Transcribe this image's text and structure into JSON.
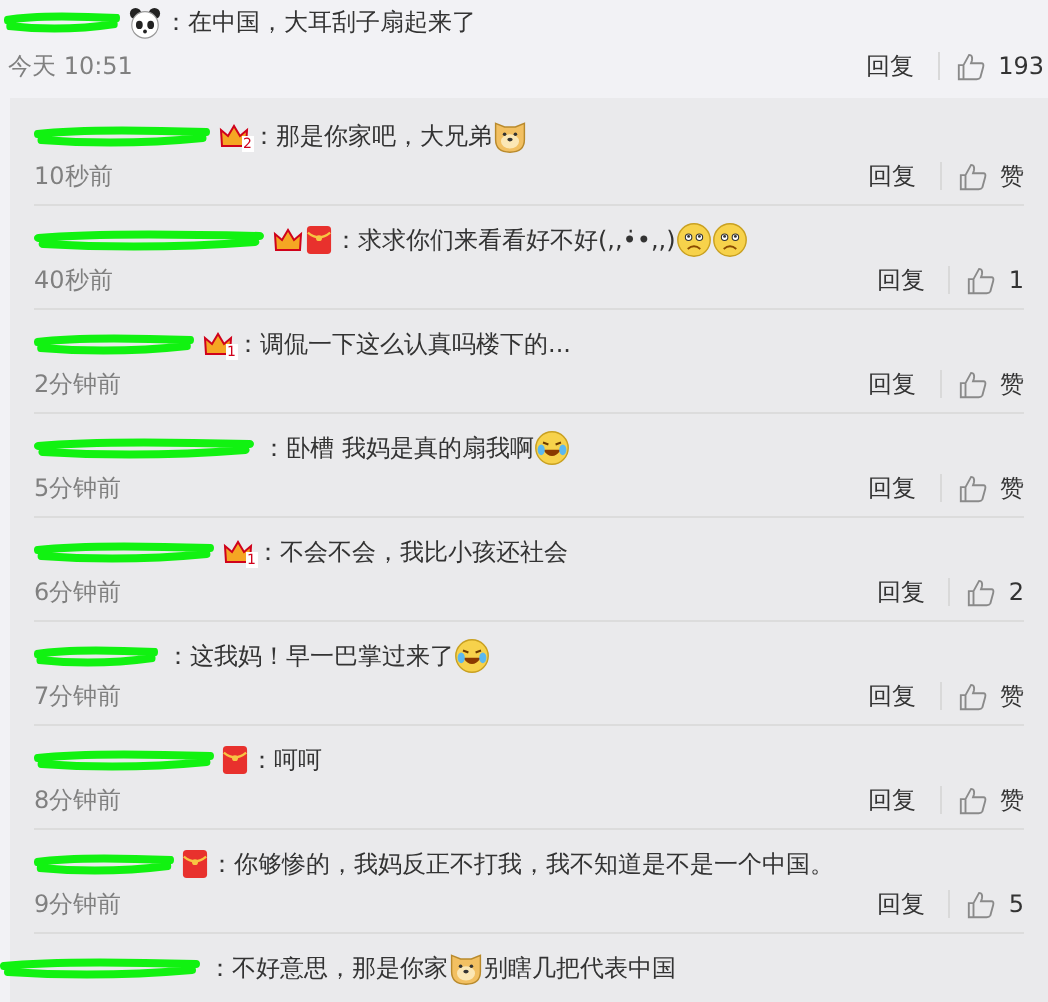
{
  "comment": {
    "badges": [
      {
        "kind": "panda"
      }
    ],
    "message": [
      {
        "kind": "text",
        "text": "：在中国，大耳刮子扇起来了"
      }
    ],
    "time": "今天 10:51",
    "reply_label": "回复",
    "like_label": "193"
  },
  "replies": [
    {
      "badges": [
        {
          "kind": "crown",
          "number": "2"
        }
      ],
      "message": [
        {
          "kind": "text",
          "text": "：那是你家吧，大兄弟"
        },
        {
          "kind": "doge"
        }
      ],
      "time": "10秒前",
      "reply_label": "回复",
      "like_label": "赞"
    },
    {
      "badges": [
        {
          "kind": "crown"
        },
        {
          "kind": "red-envelope"
        }
      ],
      "message": [
        {
          "kind": "text",
          "text": "：求求你们来看看好不好(,,•̇•,,)"
        },
        {
          "kind": "sad"
        },
        {
          "kind": "sad"
        }
      ],
      "time": "40秒前",
      "reply_label": "回复",
      "like_label": "1"
    },
    {
      "badges": [
        {
          "kind": "crown",
          "number": "1"
        }
      ],
      "message": [
        {
          "kind": "text",
          "text": "：调侃一下这么认真吗楼下的..."
        }
      ],
      "time": "2分钟前",
      "reply_label": "回复",
      "like_label": "赞"
    },
    {
      "message": [
        {
          "kind": "text",
          "text": "：卧槽 我妈是真的扇我啊"
        },
        {
          "kind": "laugh-cry"
        }
      ],
      "time": "5分钟前",
      "reply_label": "回复",
      "like_label": "赞"
    },
    {
      "badges": [
        {
          "kind": "crown",
          "number": "1"
        }
      ],
      "message": [
        {
          "kind": "text",
          "text": "：不会不会，我比小孩还社会"
        }
      ],
      "time": "6分钟前",
      "reply_label": "回复",
      "like_label": "2"
    },
    {
      "message": [
        {
          "kind": "text",
          "text": "：这我妈！早一巴掌过来了"
        },
        {
          "kind": "laugh-cry"
        }
      ],
      "time": "7分钟前",
      "reply_label": "回复",
      "like_label": "赞"
    },
    {
      "badges": [
        {
          "kind": "red-envelope"
        }
      ],
      "message": [
        {
          "kind": "text",
          "text": "：呵呵"
        }
      ],
      "time": "8分钟前",
      "reply_label": "回复",
      "like_label": "赞"
    },
    {
      "badges": [
        {
          "kind": "red-envelope"
        }
      ],
      "message": [
        {
          "kind": "text",
          "text": "：你够惨的，我妈反正不打我，我不知道是不是一个中国。"
        }
      ],
      "time": "9分钟前",
      "reply_label": "回复",
      "like_label": "5"
    },
    {
      "message": [
        {
          "kind": "text",
          "text": "：不好意思，那是你家"
        },
        {
          "kind": "doge"
        },
        {
          "kind": "text",
          "text": "别瞎几把代表中国"
        }
      ]
    }
  ]
}
